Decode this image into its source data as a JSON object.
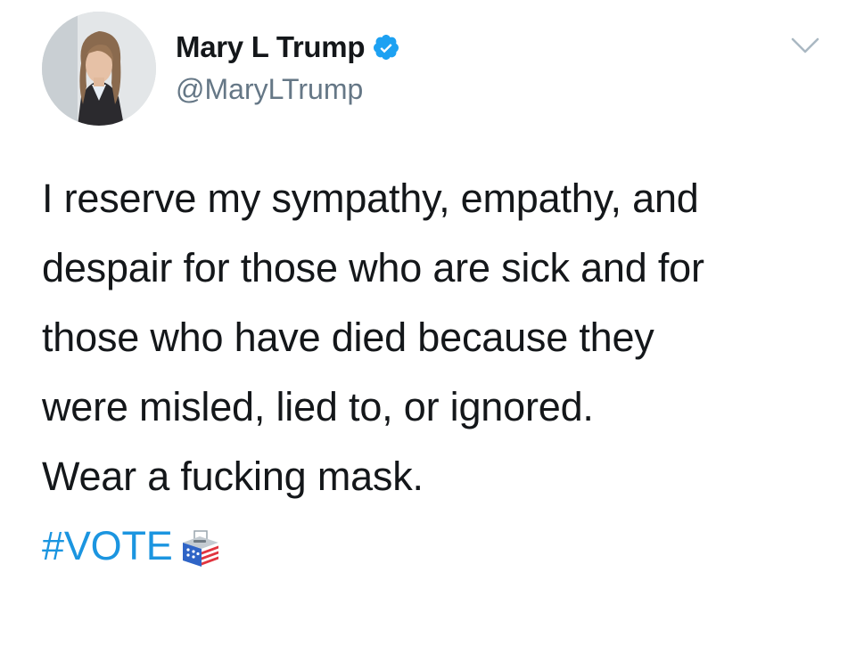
{
  "author": {
    "display_name": "Mary L Trump",
    "handle": "@MaryLTrump",
    "verified": true,
    "verified_icon": "verified-badge-icon",
    "avatar_icon": "profile-photo"
  },
  "menu": {
    "icon": "chevron-down-icon"
  },
  "tweet": {
    "paragraph1": {
      "line1": "I reserve my sympathy, empathy, and",
      "line2": "despair for those who are sick and for",
      "line3": "those who have died because they",
      "line4": "were misled, lied to, or ignored."
    },
    "paragraph2": "Wear a fucking mask.",
    "hashtag": "#VOTE",
    "hashtag_emoji_icon": "ballot-box-icon"
  },
  "colors": {
    "text": "#14171a",
    "secondary_text": "#657786",
    "link": "#1b95e0",
    "verified_badge": "#1da1f2"
  }
}
